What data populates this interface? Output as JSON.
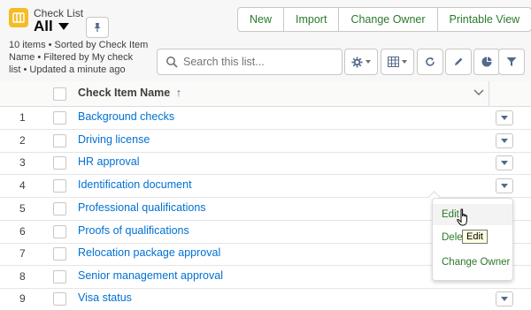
{
  "header": {
    "object_label": "Check List",
    "list_view_name": "All",
    "info_lines": [
      "10 items • Sorted by Check Item",
      "Name • Filtered by My check",
      "list • Updated a minute ago"
    ],
    "buttons": [
      "New",
      "Import",
      "Change Owner",
      "Printable View"
    ],
    "search_placeholder": "Search this list...",
    "app_icon": "checklist-icon"
  },
  "table": {
    "column_header": "Check Item Name",
    "sort_indicator": "↑",
    "rows": [
      {
        "num": "1",
        "name": "Background checks"
      },
      {
        "num": "2",
        "name": "Driving license"
      },
      {
        "num": "3",
        "name": "HR approval"
      },
      {
        "num": "4",
        "name": "Identification document"
      },
      {
        "num": "5",
        "name": "Professional qualifications"
      },
      {
        "num": "6",
        "name": "Proofs of qualifications"
      },
      {
        "num": "7",
        "name": "Relocation package approval"
      },
      {
        "num": "8",
        "name": "Senior management approval"
      },
      {
        "num": "9",
        "name": "Visa status"
      }
    ]
  },
  "row_menu": {
    "items": [
      "Edit",
      "Dele",
      "Change Owner"
    ],
    "hovered": "Edit"
  },
  "tooltip": "Edit",
  "colors": {
    "link": "#0070d2",
    "button_text": "#2a7a2a",
    "app_icon_bg": "#f4bc25"
  }
}
